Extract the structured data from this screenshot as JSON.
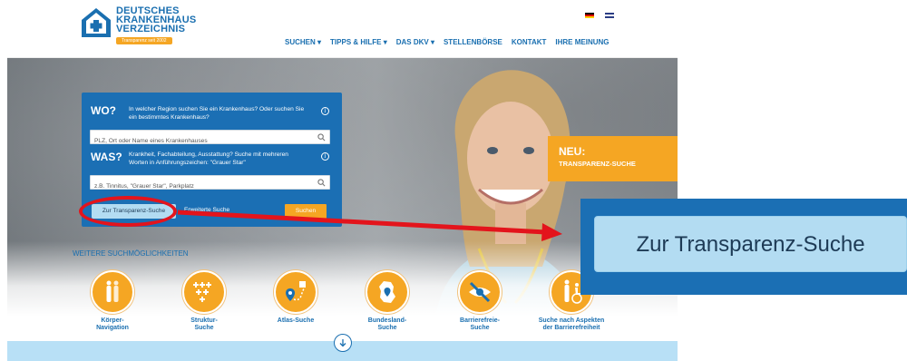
{
  "header": {
    "logo": {
      "line1": "DEUTSCHES",
      "line2": "KRANKENHAUS",
      "line3": "VERZEICHNIS",
      "tagline": "Transparenz seit 2002"
    },
    "nav": [
      "SUCHEN ▾",
      "TIPPS & HILFE ▾",
      "DAS DKV ▾",
      "STELLENBÖRSE",
      "KONTAKT",
      "IHRE MEINUNG"
    ],
    "languages": [
      "de-flag-icon",
      "uk-flag-icon"
    ]
  },
  "search": {
    "wo_label": "WO?",
    "wo_text": "In welcher Region suchen Sie ein Krankenhaus? Oder suchen Sie ein bestimmtes Krankenhaus?",
    "wo_placeholder": "PLZ, Ort oder Name eines Krankenhauses",
    "was_label": "WAS?",
    "was_text": "Krankheit, Fachabteilung, Ausstattung? Suche mit mehreren Worten in Anführungszeichen: \"Grauer Star\"",
    "was_placeholder": "z.B. Tinnitus, \"Grauer Star\", Parkplatz",
    "transparenz_button": "Zur Transparenz-Suche",
    "erweitert_link": "Erweiterte Suche",
    "submit_button": "Suchen",
    "info_icon": "i"
  },
  "neu_banner": {
    "title": "NEU:",
    "subtitle": "TRANSPARENZ-SUCHE"
  },
  "weitere": {
    "title": "WEITERE SUCHMÖGLICHKEITEN",
    "options": [
      {
        "label": "Körper-\nNavigation",
        "icon": "body-icon"
      },
      {
        "label": "Struktur-\nSuche",
        "icon": "crosses-icon"
      },
      {
        "label": "Atlas-Suche",
        "icon": "map-route-icon"
      },
      {
        "label": "Bundesland-\nSuche",
        "icon": "germany-map-icon"
      },
      {
        "label": "Barrierefreie-\nSuche",
        "icon": "eye-crossed-icon"
      },
      {
        "label": "Suche nach Aspekten\nder Barrierefreiheit",
        "icon": "wheelchair-icon"
      }
    ]
  },
  "zoom_callout": {
    "button_label": "Zur Transparenz-Suche"
  },
  "colors": {
    "brand_blue": "#1b6fb4",
    "accent_orange": "#f5a623",
    "button_light_blue": "#b3dcf2",
    "annotation_red": "#e3141c"
  }
}
